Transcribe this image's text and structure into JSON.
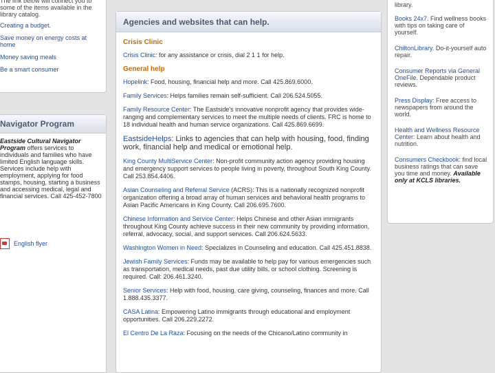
{
  "left": {
    "top_intro": "The link below will connect you to some of the items available in the library catalog.",
    "links": [
      "Creating a budget.",
      "Save money on energy costs at home",
      "Money saving meals",
      "Be a smart consumer"
    ],
    "navigator": {
      "title": "Navigator Program",
      "program_name": "Eastside Cultural Navigator Program",
      "description": "offers services to individuals and families who have limited English language skills. Services include help with employment, applying for food stamps, housing, starting a business and accessing medical, legal and financial services. Call 425-452-7800",
      "flyer": "English flyer"
    }
  },
  "main": {
    "title": "Agencies and websites that can help.",
    "sections": [
      {
        "heading": "Crisis Clinic",
        "entries": [
          {
            "name": "Crisis Clinic",
            "text": ": for any assistance or crisis, dial 2 1 1 for help.",
            "big": false
          }
        ]
      },
      {
        "heading": "General help",
        "entries": [
          {
            "name": "Hopelink",
            "text": ": Food, housing, financial help and more. Call 425.869.6000.",
            "big": false
          },
          {
            "name": "Family Services",
            "text": ": Helps families remain self-sufficient. Call 206.524.5055.",
            "big": false
          },
          {
            "name": "Family Resource Center",
            "text": ": The Eastside's innovative nonprofit agency that provides wide-ranging and complementary services to meet the multiple needs of clients. FRC is home to 18 individual health and human service organizations. Call 425.869.6699.",
            "big": false
          },
          {
            "name": "EastsideHelps",
            "text": ": Links to agencies that can help with housing, food, finding work, financial help and medical or emotional help.",
            "big": true
          },
          {
            "name": "King County MultiService Center",
            "text": ": Non-profit community action agency providing housing and emergency support services to people living in poverty, throughout South King County. Call 253.854.4406.",
            "big": false
          },
          {
            "name": "Asian Counseling and Referral Service",
            "text": " (ACRS): This is a nationally recognized nonprofit organization offering a broad array of human services and behavioral health programs to Asian Pacific Americans in King County. Call 206.695.7600.",
            "big": false
          },
          {
            "name": "Chinese Information and Service Center",
            "text": ": Helps Chinese and other Asian immigrants throughout King County achieve success in their new community by providing information, referral, advocacy, social, and support services. Call 206.624.5633.",
            "big": false
          },
          {
            "name": "Washington Women in Need",
            "text": ": Specializes in Counseling and education. Call 425.451.8838.",
            "big": false
          },
          {
            "name": "Jewish Family Services",
            "text": ": Funds may be available to help pay for various emergencies such as transportation, medical needs, past due utility bills, or school clothing. Screening is required. Call: 206.461.3240.",
            "big": false
          },
          {
            "name": "Senior Services",
            "text": ": Help with food, housing, care giving, counseling, finances and more. Call 1.888.435.3377.",
            "big": false
          },
          {
            "name": "CASA Latina",
            "text": ": Empowering Latino immigrants through educational and employment opportunities. Call 206.229.2272.",
            "big": false
          },
          {
            "name": "El Centro De La Raza",
            "text": ": Focusing on the needs of the Chicano/Latino community in",
            "big": false
          }
        ]
      }
    ]
  },
  "right": {
    "top_text": "library.",
    "items": [
      {
        "name": "Books 24x7",
        "text": ". Find wellness books with tips on taking care of yourself."
      },
      {
        "name": "ChiltonLibrary",
        "text": ". Do-it-yourself auto repair."
      },
      {
        "name": "Consumer Reports via General OneFile",
        "text": ". Dependable product reviews."
      },
      {
        "name": "Press Display",
        "text": ": Free access to newspapers from around the world."
      },
      {
        "name": "Health and Wellness Resource Center",
        "text": ": Learn about health and nutrition."
      },
      {
        "name": "Consumers Checkbook",
        "text": ": find local business ratings that can save you time and money.",
        "emphasis": "Available only at KCLS libraries."
      }
    ]
  }
}
